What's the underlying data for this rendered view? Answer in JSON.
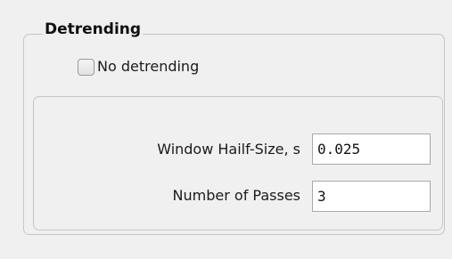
{
  "detrending": {
    "title": "Detrending",
    "no_detrending": {
      "label": "No detrending",
      "checked": false
    },
    "window_half_size": {
      "label": "Window Hailf-Size, s",
      "value": "0.025"
    },
    "number_of_passes": {
      "label": "Number of Passes",
      "value": "3"
    }
  }
}
